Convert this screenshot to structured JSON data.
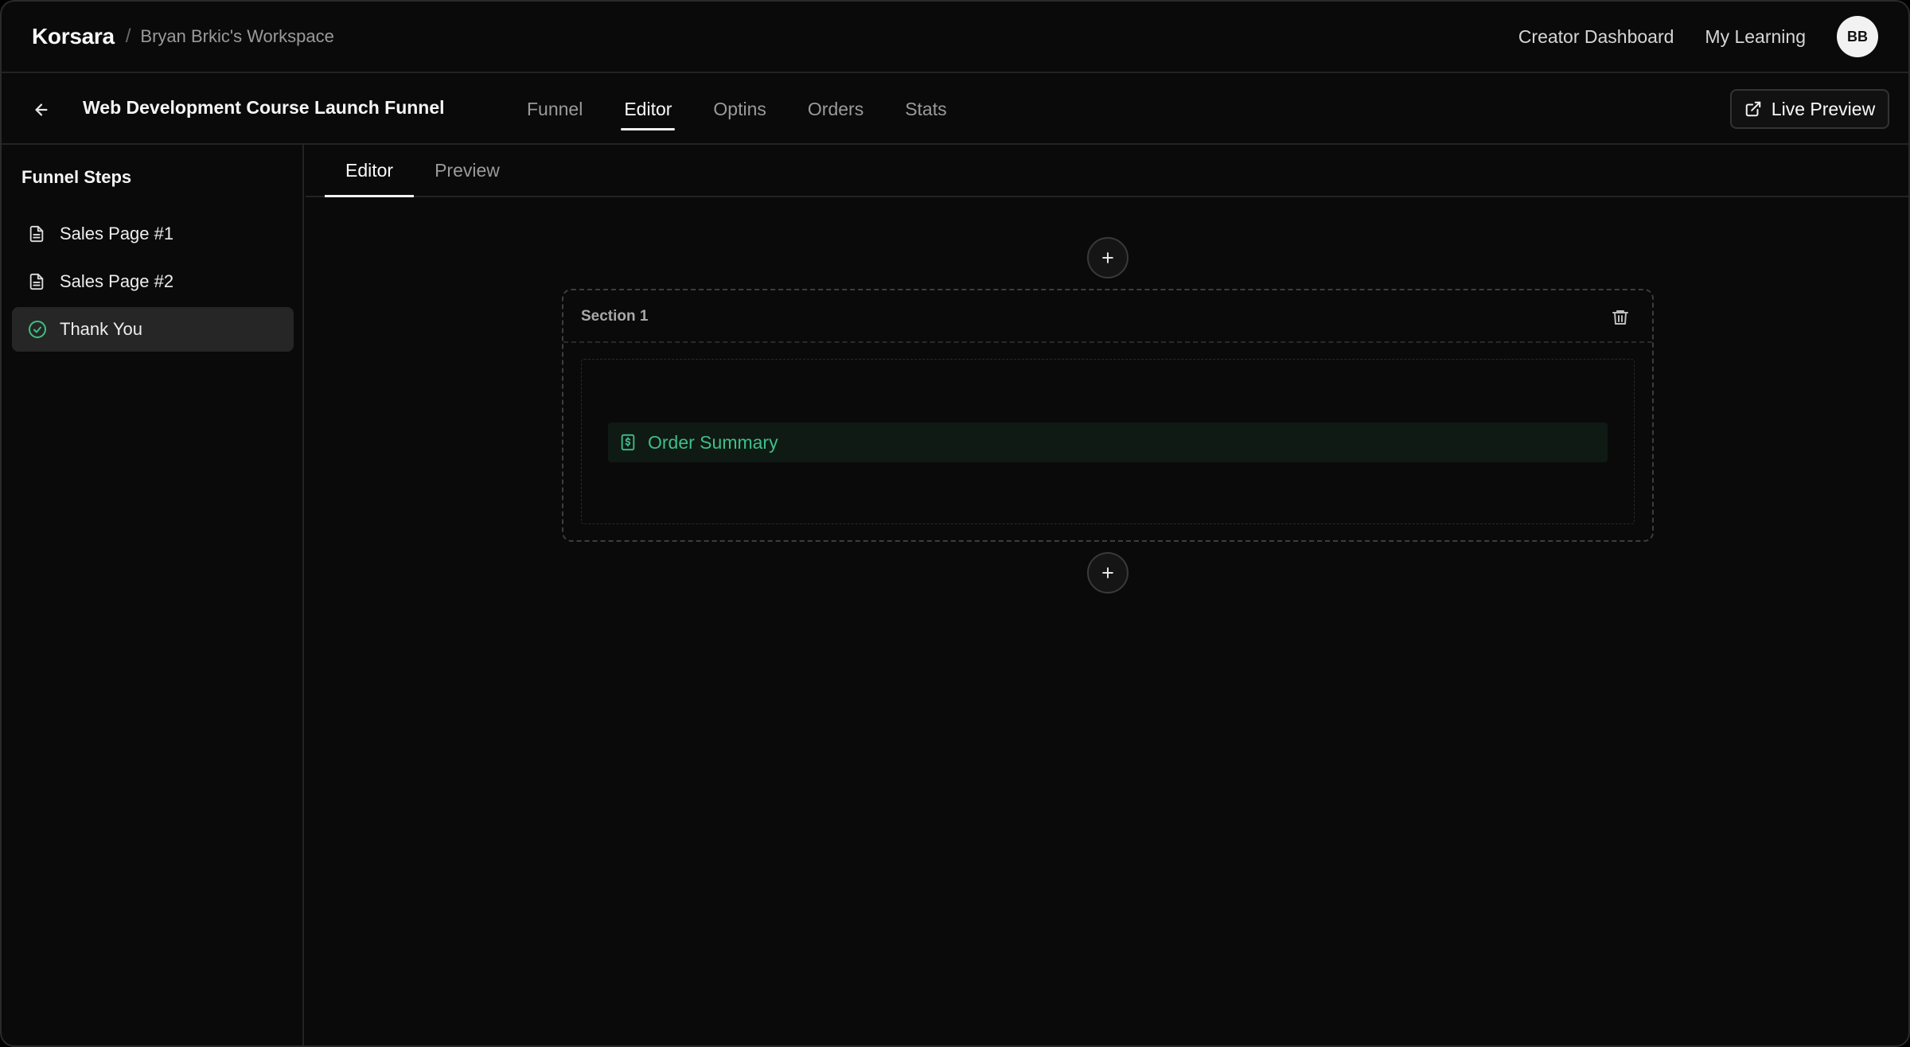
{
  "topbar": {
    "brand": "Korsara",
    "separator": "/",
    "workspace": "Bryan Brkic's Workspace",
    "links": [
      "Creator Dashboard",
      "My Learning"
    ],
    "avatar_initials": "BB"
  },
  "subbar": {
    "back_icon": "arrow-left-icon",
    "funnel_title": "Web Development Course Launch Funnel",
    "tabs": [
      {
        "label": "Funnel",
        "active": false
      },
      {
        "label": "Editor",
        "active": true
      },
      {
        "label": "Optins",
        "active": false
      },
      {
        "label": "Orders",
        "active": false
      },
      {
        "label": "Stats",
        "active": false
      }
    ],
    "live_preview_label": "Live Preview",
    "live_preview_icon": "external-link-icon"
  },
  "sidebar": {
    "title": "Funnel Steps",
    "steps": [
      {
        "label": "Sales Page #1",
        "icon": "file-text-icon",
        "active": false
      },
      {
        "label": "Sales Page #2",
        "icon": "file-text-icon",
        "active": false
      },
      {
        "label": "Thank You",
        "icon": "check-circle-icon",
        "active": true
      }
    ]
  },
  "editor": {
    "tabs": [
      {
        "label": "Editor",
        "active": true
      },
      {
        "label": "Preview",
        "active": false
      }
    ],
    "section": {
      "label": "Section 1",
      "delete_icon": "trash-icon",
      "block": {
        "label": "Order Summary",
        "icon": "receipt-dollar-icon"
      }
    },
    "add_icon": "plus-icon"
  },
  "colors": {
    "background": "#0a0a0a",
    "accent_green": "#3fbf85",
    "active_item": "#262626"
  }
}
